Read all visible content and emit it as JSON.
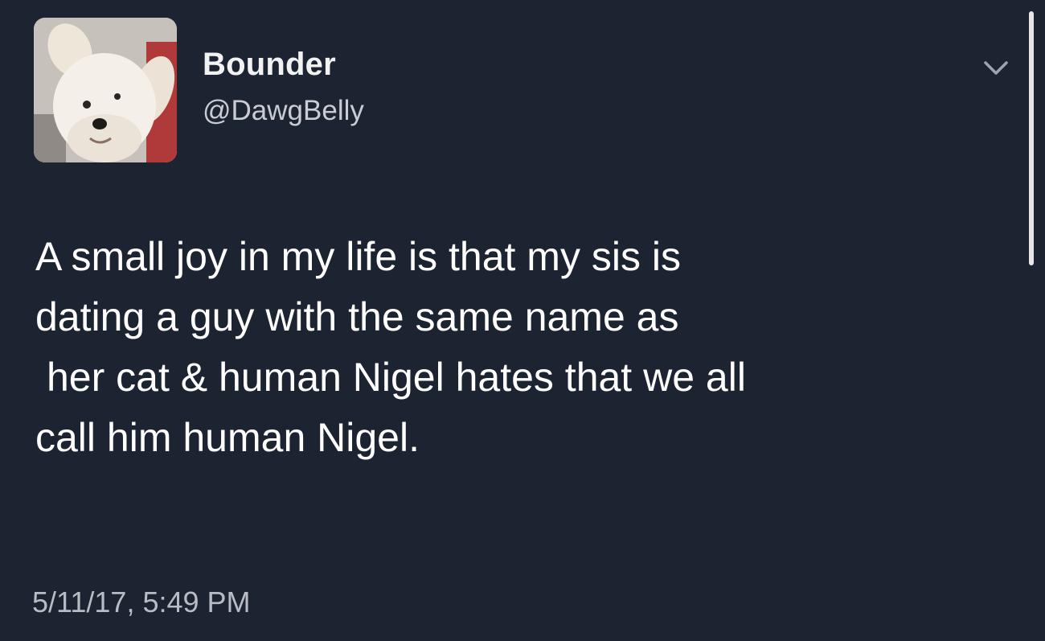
{
  "user": {
    "display_name": "Bounder",
    "handle": "@DawgBelly"
  },
  "tweet": {
    "lines": [
      "A small joy in my life is that my sis is",
      "dating a guy with the same name as",
      "her cat & human Nigel hates  that  we all",
      "call him human Nigel."
    ],
    "timestamp": "5/11/17, 5:49 PM"
  },
  "icons": {
    "menu": "chevron-down-icon",
    "avatar": "dog-avatar"
  },
  "colors": {
    "background": "#1c2331",
    "text": "#ffffff",
    "secondary_text": "#c9ccd2"
  }
}
